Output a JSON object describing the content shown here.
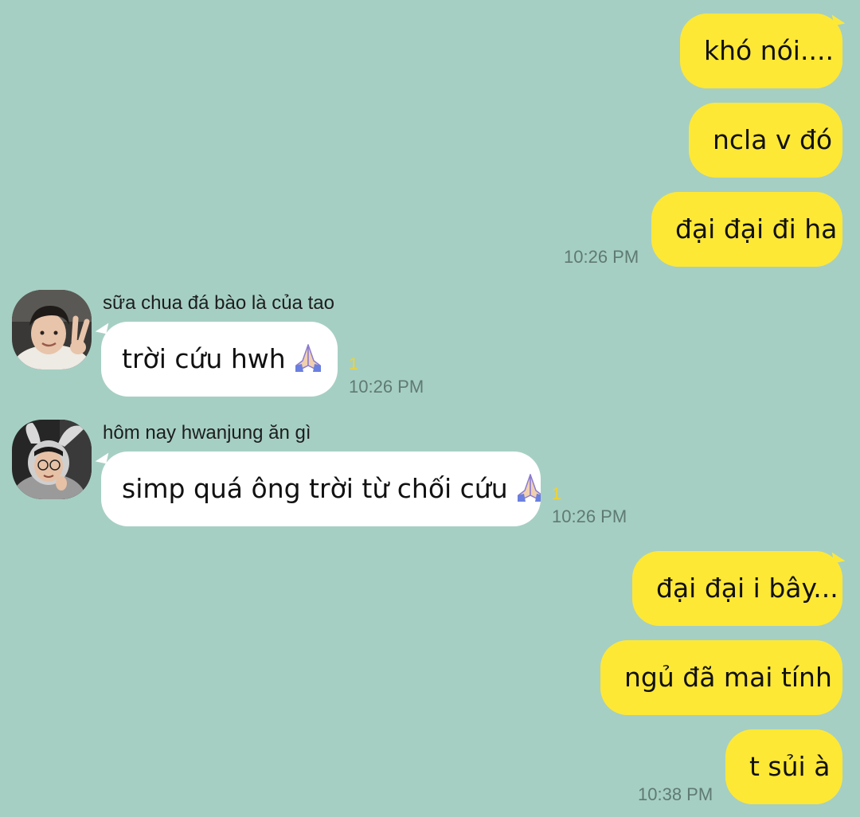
{
  "chat": {
    "messages": [
      {
        "text": "khó nói...."
      },
      {
        "text": "ncla v đó"
      },
      {
        "text": "đại đại đi ha"
      },
      {
        "time": "10:26 PM"
      },
      {
        "sender": "sữa chua đá bào là của tao",
        "text": "trời cứu hwh",
        "emoji": "folded-hands",
        "unread": "1",
        "time": "10:26 PM"
      },
      {
        "sender": "hôm nay hwanjung ăn gì",
        "text": "simp quá ông trời từ chối cứu",
        "emoji": "folded-hands",
        "unread": "1",
        "time": "10:26 PM"
      },
      {
        "text": "đại đại i bây..."
      },
      {
        "text": "ngủ đã mai tính"
      },
      {
        "text": "t sủi à"
      },
      {
        "time": "10:38 PM"
      }
    ]
  },
  "colors": {
    "background": "#a6cfc3",
    "outgoing_bubble": "#fee836",
    "incoming_bubble": "#ffffff",
    "timestamp": "#5f7a72",
    "unread_count": "#f2d22d"
  }
}
